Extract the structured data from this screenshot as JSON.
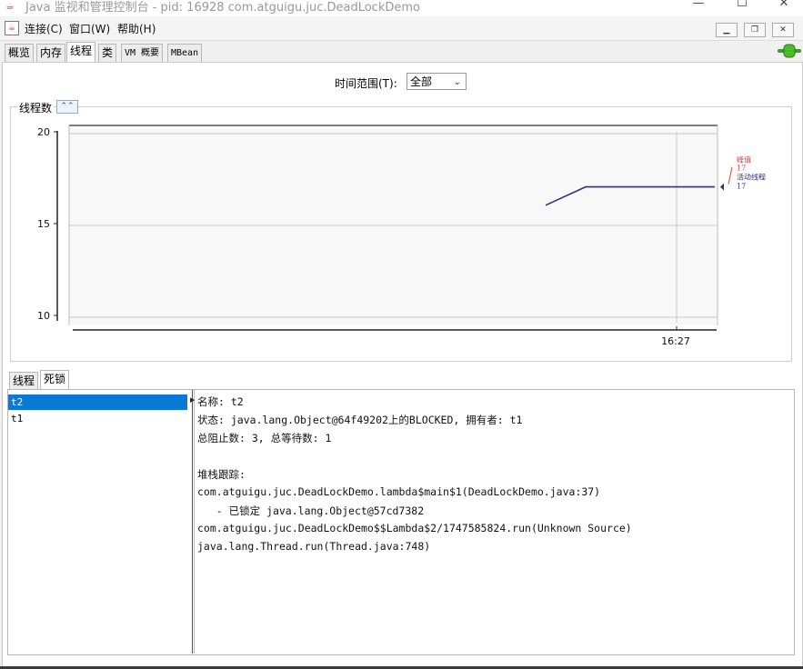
{
  "window": {
    "title": "Java 监视和管理控制台 - pid: 16928 com.atguigu.juc.DeadLockDemo",
    "minimize": "—",
    "maximize": "☐",
    "close": "✕"
  },
  "menu": {
    "items": [
      "连接(C)",
      "窗口(W)",
      "帮助(H)"
    ],
    "mdi_minimize": "▁",
    "mdi_restore": "❐",
    "mdi_close": "✕"
  },
  "tabs": [
    "概览",
    "内存",
    "线程",
    "类",
    "VM 概要",
    "MBean"
  ],
  "active_tab": "线程",
  "time_range": {
    "label": "时间范围(T):",
    "value": "全部"
  },
  "chart_panel": {
    "title": "线程数"
  },
  "chart_data": {
    "type": "line",
    "yticks": [
      "20",
      "15",
      "10"
    ],
    "ylim": [
      10,
      20
    ],
    "xtick": "16:27",
    "series": [
      {
        "name": "峰值",
        "values": [
          17
        ],
        "color": "#e04040"
      },
      {
        "name": "活动线程",
        "values": [
          16,
          17,
          17
        ],
        "color": "#3b2a8a"
      }
    ],
    "legend": [
      {
        "name": "峰值",
        "value": "17",
        "color": "#e04040"
      },
      {
        "name": "活动线程",
        "value": "17",
        "color": "#2a2a9a"
      }
    ],
    "grid": true,
    "legend_position": "right"
  },
  "lower_tabs": [
    "线程",
    "死锁"
  ],
  "active_lower_tab": "死锁",
  "threads": [
    "t2",
    "t1"
  ],
  "selected_thread": "t2",
  "details": {
    "line1": "名称: t2",
    "line2": "状态: java.lang.Object@64f49202上的BLOCKED, 拥有者: t1",
    "line3": "总阻止数: 3, 总等待数: 1",
    "line4": "堆栈跟踪:",
    "line5": "com.atguigu.juc.DeadLockDemo.lambda$main$1(DeadLockDemo.java:37)",
    "line6": "   - 已锁定 java.lang.Object@57cd7382",
    "line7": "com.atguigu.juc.DeadLockDemo$$Lambda$2/1747585824.run(Unknown Source)",
    "line8": "java.lang.Thread.run(Thread.java:748)"
  }
}
